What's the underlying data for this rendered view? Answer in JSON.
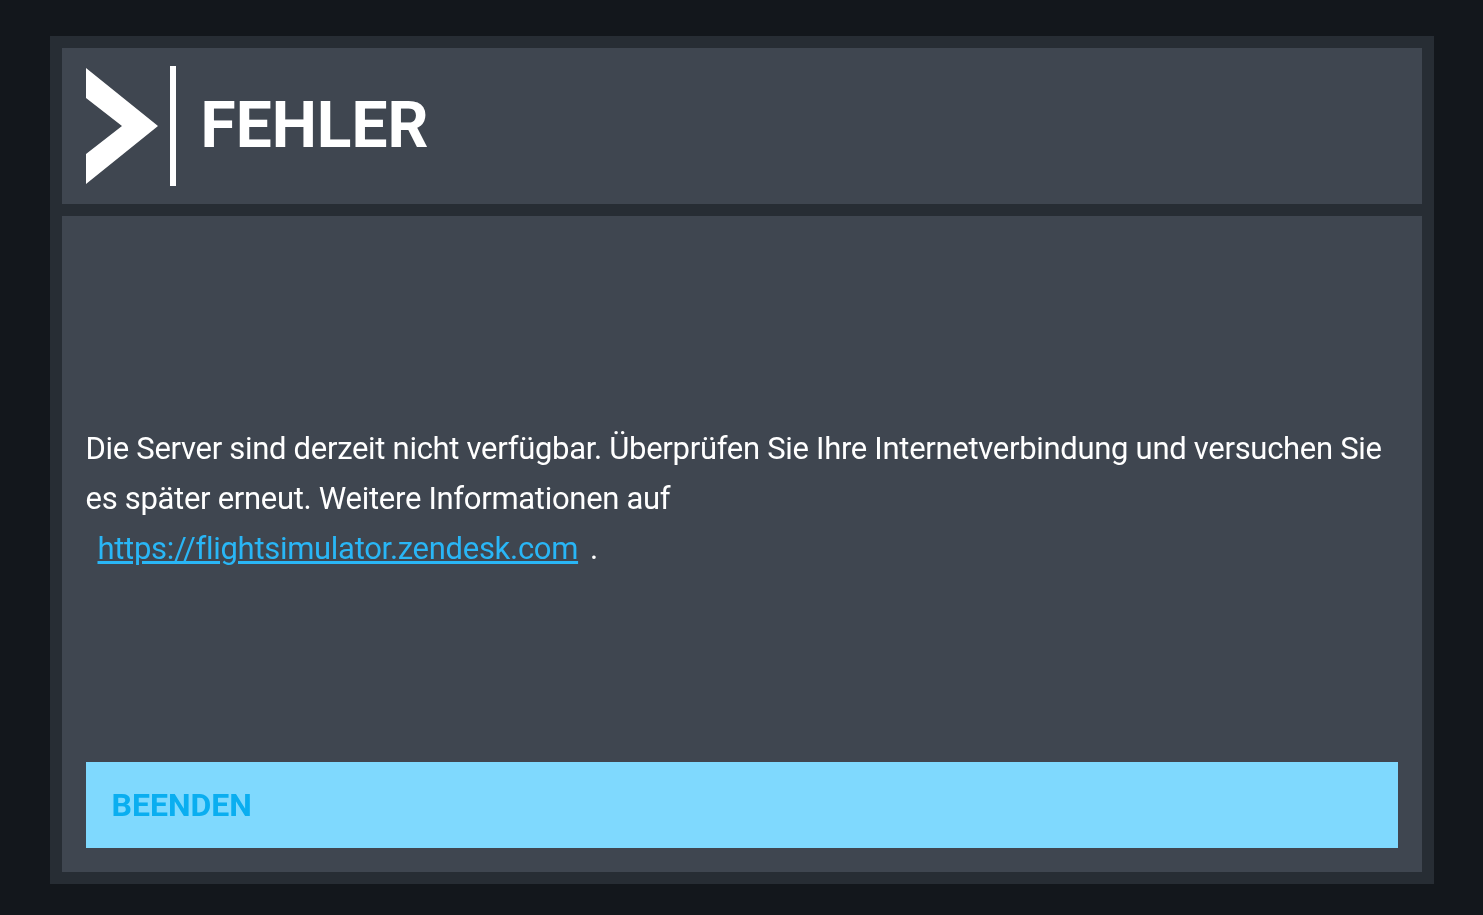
{
  "dialog": {
    "title": "FEHLER",
    "message": {
      "text": "Die Server sind derzeit nicht verfügbar. Überprüfen Sie Ihre Internetverbindung und versuchen Sie es später erneut. Weitere Informationen auf",
      "link": "https://flightsimulator.zendesk.com",
      "end": "."
    },
    "buttons": [
      {
        "label": "BEENDEN"
      }
    ]
  }
}
